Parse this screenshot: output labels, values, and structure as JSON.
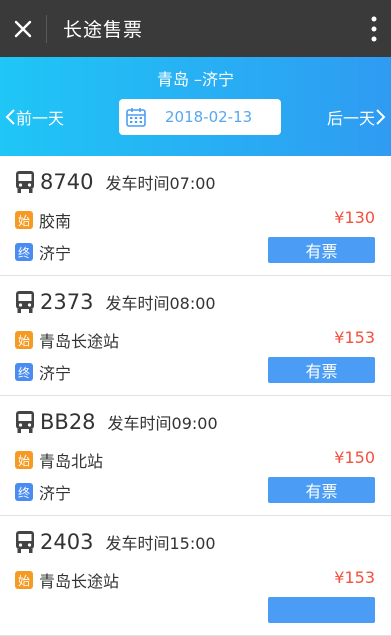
{
  "app": {
    "title": "长途售票"
  },
  "header": {
    "route": "青岛 –济宁",
    "prev_day": "前一天",
    "next_day": "后一天",
    "date": "2018-02-13"
  },
  "tags": {
    "start": "始",
    "end": "终"
  },
  "trips": [
    {
      "bus_no": "8740",
      "depart": "发车时间07:00",
      "from": "胶南",
      "to": "济宁",
      "price": "¥130",
      "status": "有票"
    },
    {
      "bus_no": "2373",
      "depart": "发车时间08:00",
      "from": "青岛长途站",
      "to": "济宁",
      "price": "¥153",
      "status": "有票"
    },
    {
      "bus_no": "BB28",
      "depart": "发车时间09:00",
      "from": "青岛北站",
      "to": "济宁",
      "price": "¥150",
      "status": "有票"
    },
    {
      "bus_no": "2403",
      "depart": "发车时间15:00",
      "from": "青岛长途站",
      "to": "",
      "price": "¥153",
      "status": ""
    }
  ],
  "colors": {
    "topbar": "#3a3a3a",
    "accent": "#4b9cf5",
    "price": "#f4513c",
    "start_tag": "#f59a23",
    "end_tag": "#4a8cf2"
  },
  "icons": [
    "close-icon",
    "more-icon",
    "chevron-left-icon",
    "chevron-right-icon",
    "calendar-icon",
    "bus-icon"
  ]
}
